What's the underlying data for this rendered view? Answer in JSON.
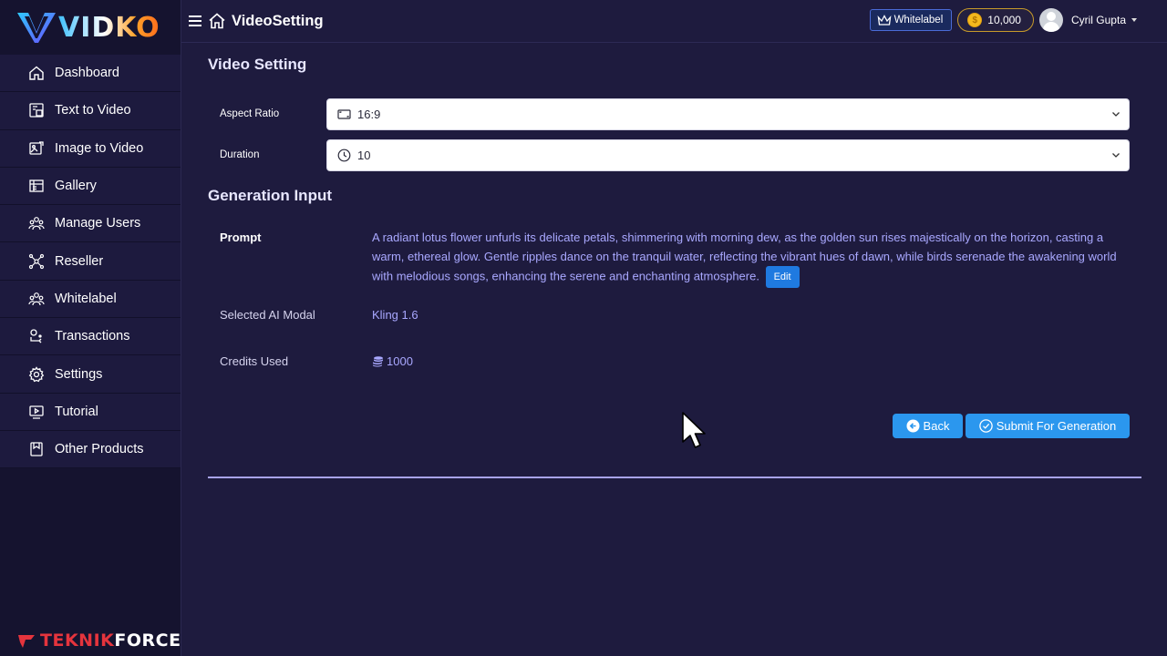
{
  "brand": {
    "logo": "VIDKO",
    "footer_left": "TEKNIK",
    "footer_right": "FORCE"
  },
  "sidebar": {
    "items": [
      {
        "label": "Dashboard",
        "icon": "home-icon"
      },
      {
        "label": "Text to Video",
        "icon": "text-video-icon"
      },
      {
        "label": "Image to Video",
        "icon": "image-video-icon"
      },
      {
        "label": "Gallery",
        "icon": "gallery-icon"
      },
      {
        "label": "Manage Users",
        "icon": "users-icon"
      },
      {
        "label": "Reseller",
        "icon": "reseller-icon"
      },
      {
        "label": "Whitelabel",
        "icon": "whitelabel-icon"
      },
      {
        "label": "Transactions",
        "icon": "transactions-icon"
      },
      {
        "label": "Settings",
        "icon": "gear-icon"
      },
      {
        "label": "Tutorial",
        "icon": "tutorial-icon"
      },
      {
        "label": "Other Products",
        "icon": "products-icon"
      }
    ]
  },
  "header": {
    "title": "VideoSetting",
    "whitelabel_label": "Whitelabel",
    "credits": "10,000",
    "user_name": "Cyril Gupta"
  },
  "video_setting": {
    "title": "Video Setting",
    "aspect_label": "Aspect Ratio",
    "aspect_value": "16:9",
    "duration_label": "Duration",
    "duration_value": "10"
  },
  "generation": {
    "title": "Generation Input",
    "prompt_label": "Prompt",
    "prompt_text": "A radiant lotus flower unfurls its delicate petals, shimmering with morning dew, as the golden sun rises majestically on the horizon, casting a warm, ethereal glow. Gentle ripples dance on the tranquil water, reflecting the vibrant hues of dawn, while birds serenade the awakening world with melodious songs, enhancing the serene and enchanting atmosphere.",
    "edit_label": "Edit",
    "model_label": "Selected AI Modal",
    "model_value": "Kling 1.6",
    "credits_label": "Credits Used",
    "credits_value": "1000"
  },
  "actions": {
    "back_label": "Back",
    "submit_label": "Submit For Generation"
  },
  "colors": {
    "background": "#1e1b3e",
    "sidebar": "#15132f",
    "accent": "#2b97ee",
    "value_text": "#a9a8ff"
  }
}
